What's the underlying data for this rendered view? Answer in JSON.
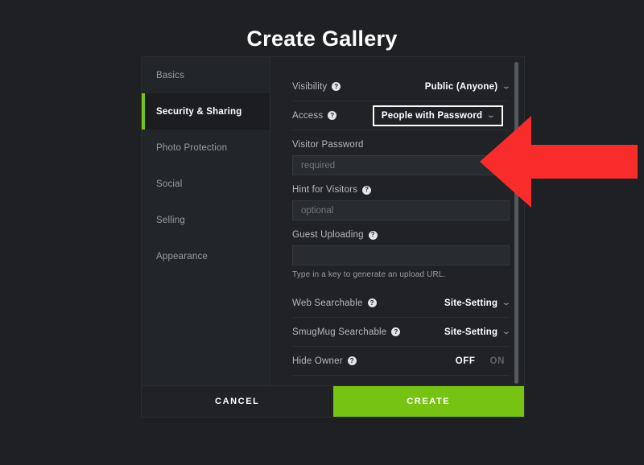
{
  "header": {
    "title": "Create Gallery"
  },
  "colors": {
    "accent_green": "#76c313",
    "annotation_red": "#f92c2c",
    "background": "#1e2023",
    "panel": "#202226",
    "sidebar": "#232629"
  },
  "sidebar": {
    "items": [
      {
        "label": "Basics",
        "active": false
      },
      {
        "label": "Security & Sharing",
        "active": true
      },
      {
        "label": "Photo Protection",
        "active": false
      },
      {
        "label": "Social",
        "active": false
      },
      {
        "label": "Selling",
        "active": false
      },
      {
        "label": "Appearance",
        "active": false
      }
    ]
  },
  "form": {
    "visibility": {
      "label": "Visibility",
      "help_icon": "question-mark-icon",
      "value": "Public (Anyone)",
      "chevron": "chevron-down-icon"
    },
    "access": {
      "label": "Access",
      "help_icon": "question-mark-icon",
      "value": "People with Password",
      "chevron": "chevron-down-icon"
    },
    "visitor_password": {
      "label": "Visitor Password",
      "value": "",
      "placeholder": "required"
    },
    "hint_for_visitors": {
      "label": "Hint for Visitors",
      "help_icon": "question-mark-icon",
      "value": "",
      "placeholder": "optional"
    },
    "guest_uploading": {
      "label": "Guest Uploading",
      "help_icon": "question-mark-icon",
      "value": "",
      "placeholder": "",
      "hint": "Type in a key to generate an upload URL."
    },
    "web_searchable": {
      "label": "Web Searchable",
      "help_icon": "question-mark-icon",
      "value": "Site-Setting",
      "chevron": "chevron-down-icon"
    },
    "smugmug_searchable": {
      "label": "SmugMug Searchable",
      "help_icon": "question-mark-icon",
      "value": "Site-Setting",
      "chevron": "chevron-down-icon"
    },
    "hide_owner": {
      "label": "Hide Owner",
      "help_icon": "question-mark-icon",
      "off_label": "OFF",
      "on_label": "ON",
      "selected": "OFF"
    }
  },
  "footer": {
    "cancel_label": "CANCEL",
    "create_label": "CREATE"
  },
  "annotation": {
    "arrow_icon": "arrow-left-icon",
    "color": "#f92c2c"
  },
  "scrollbar": {
    "name": "vertical-scrollbar"
  }
}
